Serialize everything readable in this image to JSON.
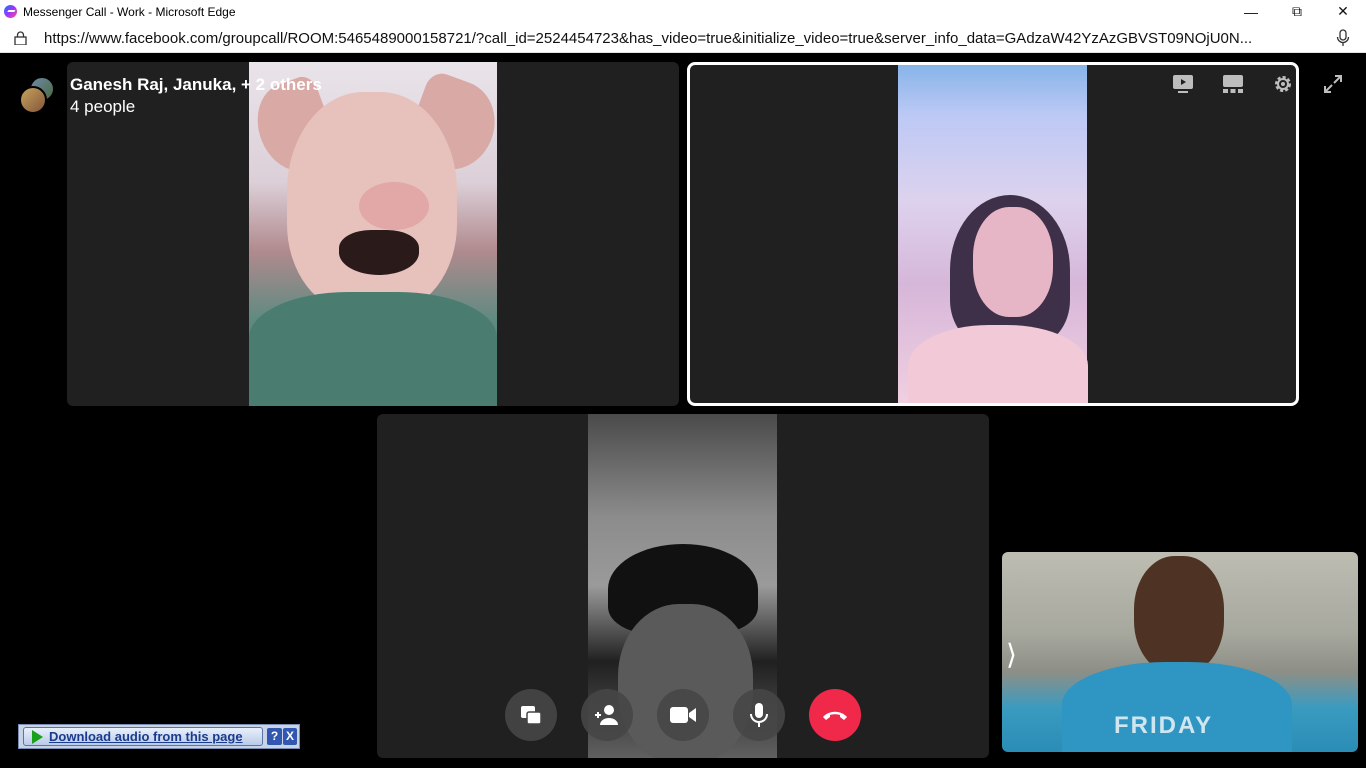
{
  "window": {
    "title": "Messenger Call - Work - Microsoft Edge",
    "minimize_glyph": "—",
    "maximize_glyph": "⧉",
    "close_glyph": "✕"
  },
  "address_bar": {
    "url": "https://www.facebook.com/groupcall/ROOM:5465489000158721/?call_id=2524454723&has_video=true&initialize_video=true&server_info_data=GAdzaW42YzAzGBVST09NOjU0N..."
  },
  "call": {
    "title": "Ganesh Raj, Januka, + 2 others",
    "participant_count": "4 people",
    "self_view_shirt_text": "FRIDAY"
  },
  "controls": {
    "icons": [
      "screen-share-icon",
      "add-user-icon",
      "video-camera-icon",
      "microphone-icon",
      "end-call-icon"
    ]
  },
  "toolbar": {
    "icons": [
      "share-screen-icon",
      "layout-icon",
      "settings-icon",
      "fullscreen-icon"
    ]
  },
  "download_widget": {
    "label": "Download audio from this page",
    "help": "?",
    "close": "X"
  },
  "colors": {
    "end_call": "#f02849",
    "tile_bg": "#202020",
    "page_bg": "#000000"
  }
}
